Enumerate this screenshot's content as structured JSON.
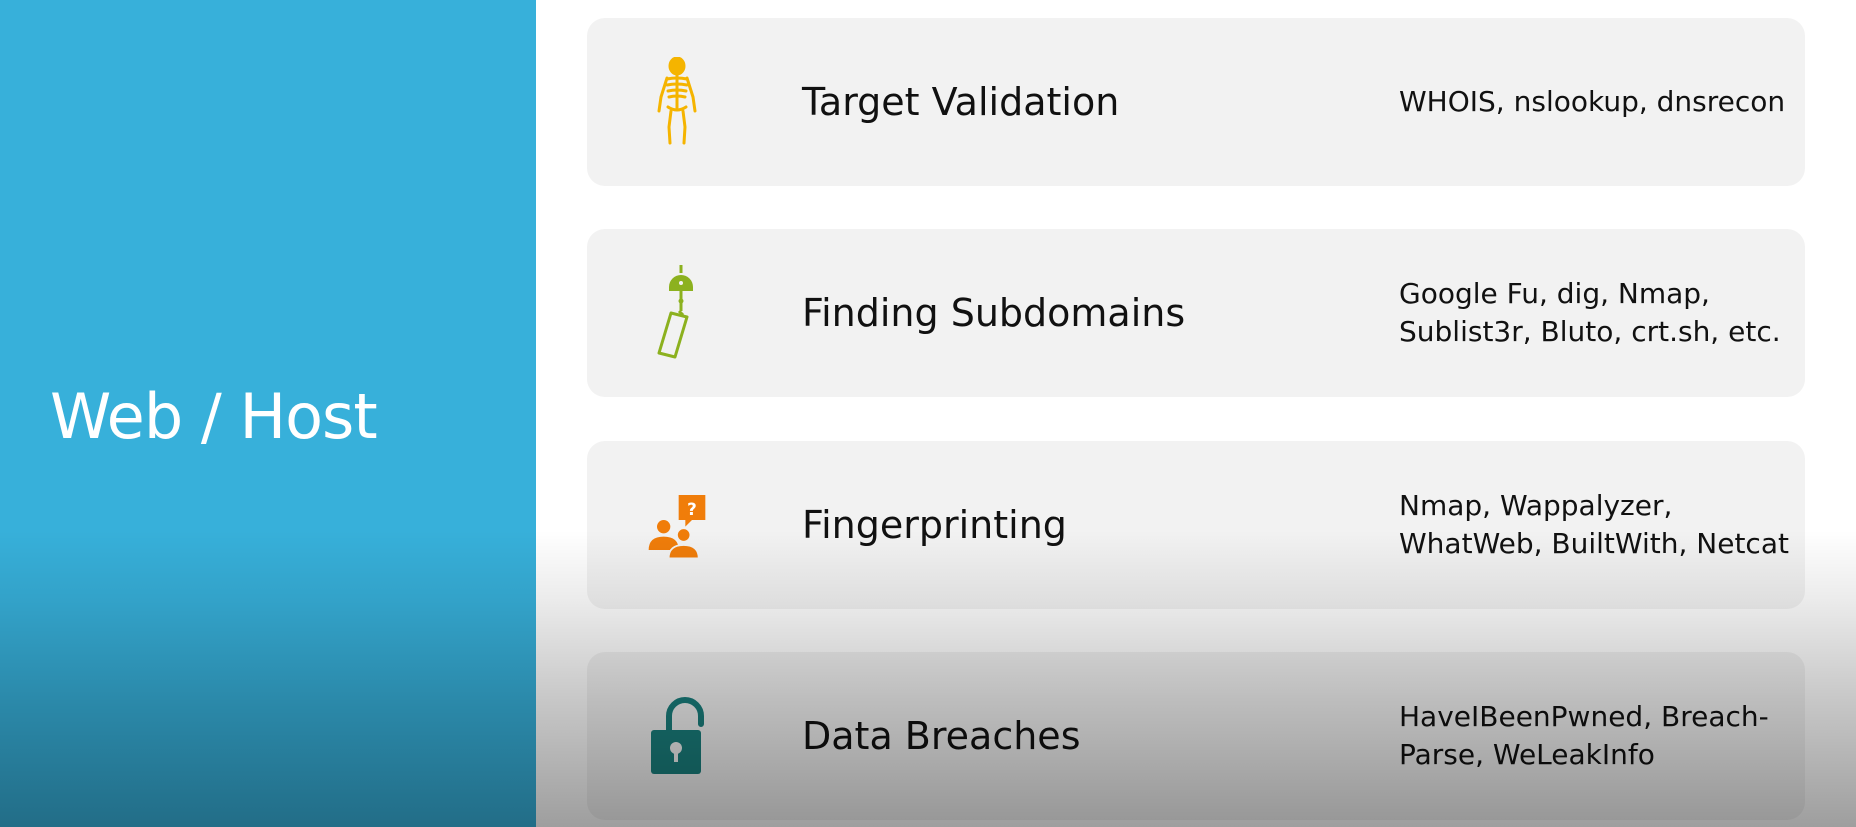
{
  "sidebar": {
    "title": "Web / Host",
    "color": "#37b0da"
  },
  "cards": [
    {
      "title": "Target Validation",
      "tools": [
        "WHOIS, nslookup, dnsrecon"
      ],
      "icon": "skeleton-icon",
      "icon_color": "#f5b400"
    },
    {
      "title": "Finding Subdomains",
      "tools": [
        "Google Fu, dig, Nmap,",
        "Sublist3r, Bluto, crt.sh, etc."
      ],
      "icon": "wind-chime-icon",
      "icon_color": "#8cb11f"
    },
    {
      "title": "Fingerprinting",
      "tools": [
        "Nmap, Wappalyzer,",
        "WhatWeb, BuiltWith, Netcat"
      ],
      "icon": "people-question-icon",
      "icon_color": "#f07d0a"
    },
    {
      "title": "Data Breaches",
      "tools": [
        "HaveIBeenPwned, Breach-",
        "Parse, WeLeakInfo"
      ],
      "icon": "unlocked-padlock-icon",
      "icon_color": "#1a7f7d"
    }
  ]
}
